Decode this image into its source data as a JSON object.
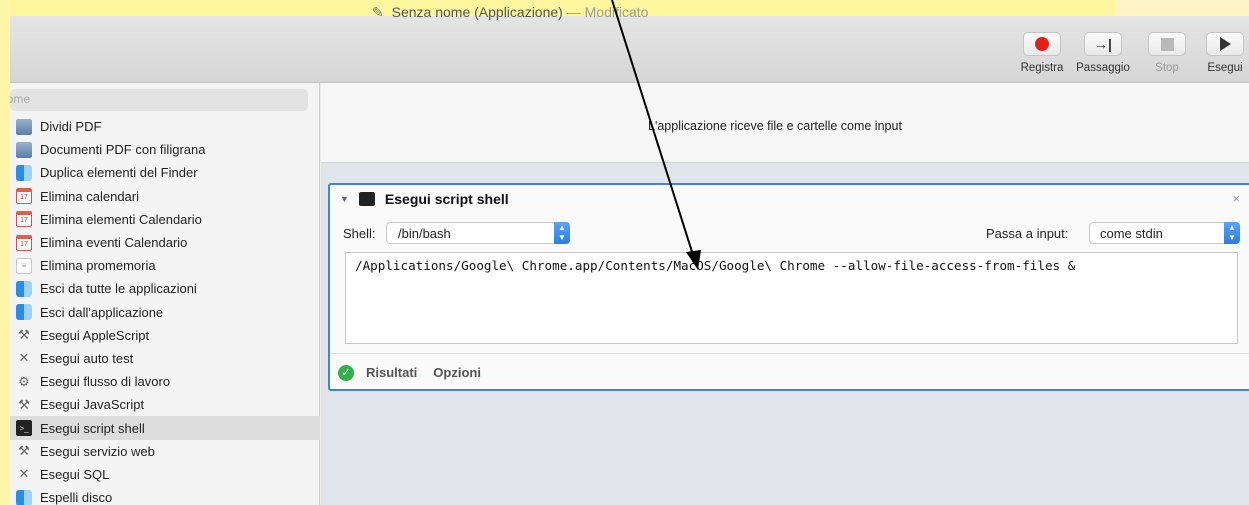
{
  "window": {
    "title": "Senza nome (Applicazione)",
    "title_separator": "—",
    "title_status": "Modificato"
  },
  "toolbar": {
    "record": "Registra",
    "step": "Passaggio",
    "stop": "Stop",
    "run": "Esegui"
  },
  "sidebar": {
    "search_placeholder": "Nome",
    "items": [
      {
        "label": "Dividi PDF",
        "icon": "pdf-icon"
      },
      {
        "label": "Documenti PDF con filigrana",
        "icon": "pdf-icon"
      },
      {
        "label": "Duplica elementi del Finder",
        "icon": "finder-icon"
      },
      {
        "label": "Elimina calendari",
        "icon": "calendar-icon"
      },
      {
        "label": "Elimina elementi Calendario",
        "icon": "calendar-icon"
      },
      {
        "label": "Elimina eventi Calendario",
        "icon": "calendar-icon"
      },
      {
        "label": "Elimina promemoria",
        "icon": "reminders-icon"
      },
      {
        "label": "Esci da tutte le applicazioni",
        "icon": "finder-icon"
      },
      {
        "label": "Esci dall'applicazione",
        "icon": "finder-icon"
      },
      {
        "label": "Esegui AppleScript",
        "icon": "script-icon"
      },
      {
        "label": "Esegui auto test",
        "icon": "tools-icon"
      },
      {
        "label": "Esegui flusso di lavoro",
        "icon": "automator-icon"
      },
      {
        "label": "Esegui JavaScript",
        "icon": "script-icon"
      },
      {
        "label": "Esegui script shell",
        "icon": "terminal-icon",
        "selected": true
      },
      {
        "label": "Esegui servizio web",
        "icon": "script-icon"
      },
      {
        "label": "Esegui SQL",
        "icon": "tools-icon"
      },
      {
        "label": "Espelli disco",
        "icon": "finder-icon"
      }
    ]
  },
  "main": {
    "input_description": "L'applicazione riceve file e cartelle come input"
  },
  "action": {
    "title": "Esegui script shell",
    "shell_label": "Shell:",
    "shell_value": "/bin/bash",
    "pass_input_label": "Passa a input:",
    "pass_input_value": "come stdin",
    "script": "/Applications/Google\\ Chrome.app/Contents/MacOS/Google\\ Chrome --allow-file-access-from-files &",
    "results_label": "Risultati",
    "options_label": "Opzioni"
  },
  "colors": {
    "accent": "#3d86d8",
    "record": "#e0211c",
    "success": "#2fb14c",
    "background_highlight": "#fdf69e"
  }
}
